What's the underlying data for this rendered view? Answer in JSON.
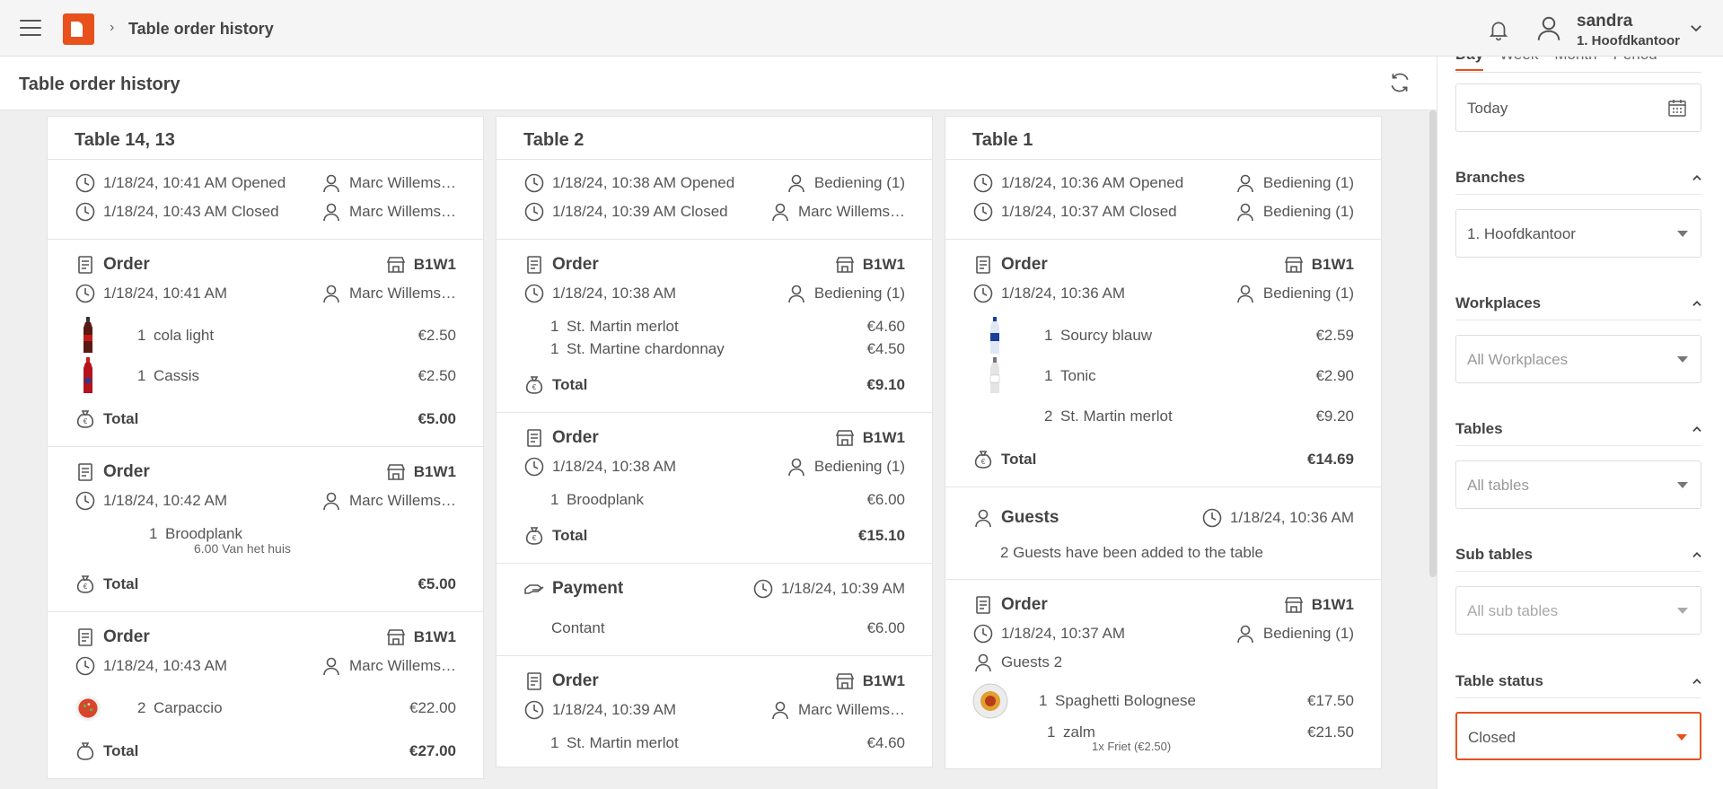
{
  "header": {
    "breadcrumb_title": "Table order history",
    "user_name": "sandra",
    "user_branch": "1. Hoofdkantoor"
  },
  "page": {
    "title": "Table order history"
  },
  "columns": [
    {
      "title": "Table 14, 13",
      "opened": "1/18/24, 10:41 AM Opened",
      "opened_by": "Marc Willems…",
      "closed": "1/18/24, 10:43 AM Closed",
      "closed_by": "Marc Willems…",
      "orders": [
        {
          "label": "Order",
          "location": "B1W1",
          "time": "1/18/24, 10:41 AM",
          "by": "Marc Willems…",
          "items": [
            {
              "qty": "1",
              "name": "cola light",
              "price": "€2.50",
              "thumb": "cola-bottle"
            },
            {
              "qty": "1",
              "name": "Cassis",
              "price": "€2.50",
              "thumb": "cassis-bottle"
            }
          ],
          "total_label": "Total",
          "total": "€5.00"
        },
        {
          "label": "Order",
          "location": "B1W1",
          "time": "1/18/24, 10:42 AM",
          "by": "Marc Willems…",
          "items": [
            {
              "qty": "1",
              "name": "Broodplank",
              "price": "",
              "note": "6.00 Van het huis"
            }
          ],
          "total_label": "Total",
          "total": "€5.00"
        },
        {
          "label": "Order",
          "location": "B1W1",
          "time": "1/18/24, 10:43 AM",
          "by": "Marc Willems…",
          "items": [
            {
              "qty": "2",
              "name": "Carpaccio",
              "price": "€22.00",
              "thumb": "carpaccio-plate"
            }
          ],
          "total_label": "Total",
          "total": "€27.00"
        }
      ]
    },
    {
      "title": "Table 2",
      "opened": "1/18/24, 10:38 AM Opened",
      "opened_by": "Bediening (1)",
      "closed": "1/18/24, 10:39 AM Closed",
      "closed_by": "Marc Willems…",
      "orders": [
        {
          "label": "Order",
          "location": "B1W1",
          "time": "1/18/24, 10:38 AM",
          "by": "Bediening (1)",
          "items": [
            {
              "qty": "1",
              "name": "St. Martin merlot",
              "price": "€4.60"
            },
            {
              "qty": "1",
              "name": "St. Martine chardonnay",
              "price": "€4.50"
            }
          ],
          "total_label": "Total",
          "total": "€9.10"
        },
        {
          "label": "Order",
          "location": "B1W1",
          "time": "1/18/24, 10:38 AM",
          "by": "Bediening (1)",
          "items": [
            {
              "qty": "1",
              "name": "Broodplank",
              "price": "€6.00"
            }
          ],
          "total_label": "Total",
          "total": "€15.10"
        }
      ],
      "payment": {
        "label": "Payment",
        "time": "1/18/24, 10:39 AM",
        "method": "Contant",
        "amount": "€6.00"
      },
      "order_last": {
        "label": "Order",
        "location": "B1W1",
        "time": "1/18/24, 10:39 AM",
        "by": "Marc Willems…",
        "items": [
          {
            "qty": "1",
            "name": "St. Martin merlot",
            "price": "€4.60"
          }
        ]
      }
    },
    {
      "title": "Table 1",
      "opened": "1/18/24, 10:36 AM Opened",
      "opened_by": "Bediening (1)",
      "closed": "1/18/24, 10:37 AM Closed",
      "closed_by": "Bediening (1)",
      "orders": [
        {
          "label": "Order",
          "location": "B1W1",
          "time": "1/18/24, 10:36 AM",
          "by": "Bediening (1)",
          "items": [
            {
              "qty": "1",
              "name": "Sourcy blauw",
              "price": "€2.59",
              "thumb": "water-bottle"
            },
            {
              "qty": "1",
              "name": "Tonic",
              "price": "€2.90",
              "thumb": "tonic-bottle"
            },
            {
              "qty": "2",
              "name": "St. Martin merlot",
              "price": "€9.20"
            }
          ],
          "total_label": "Total",
          "total": "€14.69"
        }
      ],
      "guests": {
        "label": "Guests",
        "time": "1/18/24, 10:36 AM",
        "text": "2 Guests have been added to the table"
      },
      "order_last": {
        "label": "Order",
        "location": "B1W1",
        "time": "1/18/24, 10:37 AM",
        "by": "Bediening (1)",
        "guests": "Guests 2",
        "items": [
          {
            "qty": "1",
            "name": "Spaghetti Bolognese",
            "price": "€17.50",
            "thumb": "spaghetti-plate"
          },
          {
            "qty": "1",
            "name": "zalm",
            "price": "€21.50",
            "note": "1x Friet (€2.50)"
          }
        ]
      }
    }
  ],
  "sidebar": {
    "tabs": [
      "Day",
      "Week",
      "Month",
      "Period"
    ],
    "date_value": "Today",
    "groups": [
      {
        "title": "Branches",
        "value": "1. Hoofdkantoor",
        "placeholder": false
      },
      {
        "title": "Workplaces",
        "value": "All Workplaces",
        "placeholder": true
      },
      {
        "title": "Tables",
        "value": "All tables",
        "placeholder": true
      },
      {
        "title": "Sub tables",
        "value": "All sub tables",
        "placeholder": true
      },
      {
        "title": "Table status",
        "value": "Closed",
        "placeholder": false
      }
    ]
  },
  "colors": {
    "accent": "#e8501c",
    "text": "#555555",
    "heading": "#444444"
  }
}
